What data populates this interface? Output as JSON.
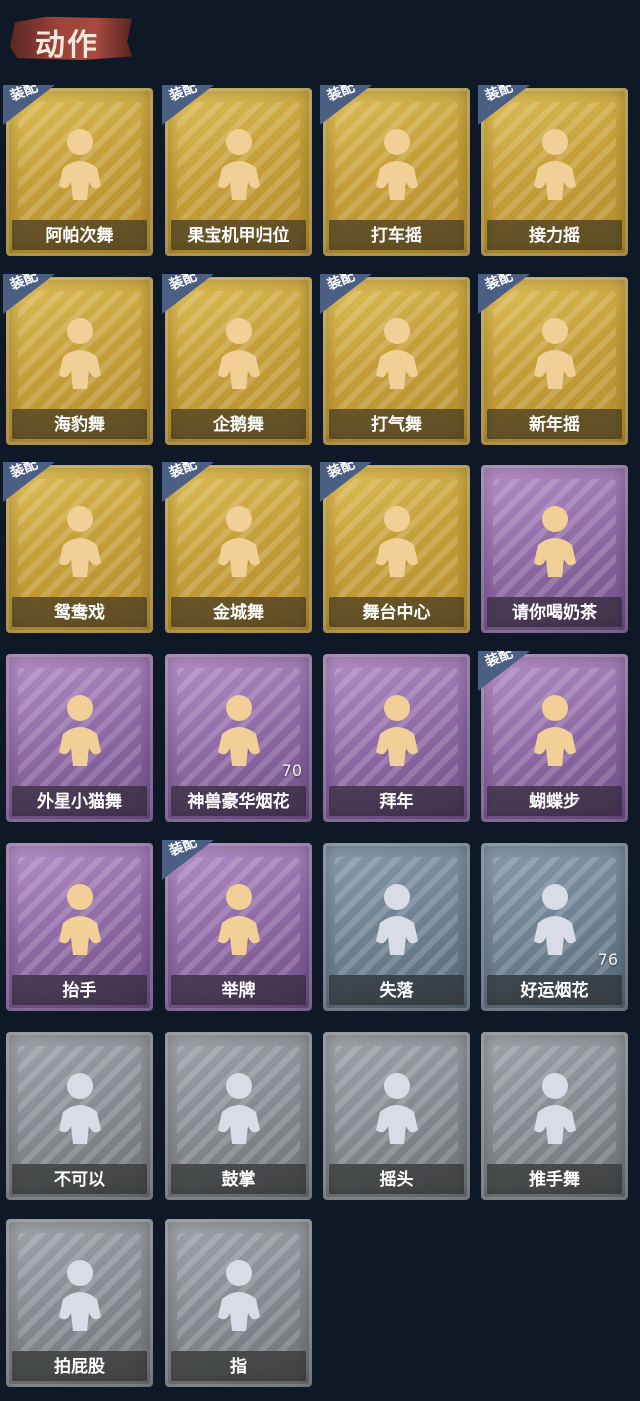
{
  "header": {
    "title": "动作"
  },
  "equip_label": "装配",
  "cards": [
    {
      "label": "阿帕次舞",
      "rarity": "gold",
      "equipped": true,
      "icon": "dancer-icon"
    },
    {
      "label": "果宝机甲归位",
      "rarity": "gold",
      "equipped": true,
      "icon": "dancer-icon"
    },
    {
      "label": "打车摇",
      "rarity": "gold",
      "equipped": true,
      "icon": "dancer-icon"
    },
    {
      "label": "接力摇",
      "rarity": "gold",
      "equipped": true,
      "icon": "dancer-icon"
    },
    {
      "label": "海豹舞",
      "rarity": "gold",
      "equipped": true,
      "icon": "dancer-icon"
    },
    {
      "label": "企鹅舞",
      "rarity": "gold",
      "equipped": true,
      "icon": "dancer-icon"
    },
    {
      "label": "打气舞",
      "rarity": "gold",
      "equipped": true,
      "icon": "dancer-icon"
    },
    {
      "label": "新年摇",
      "rarity": "gold",
      "equipped": true,
      "icon": "dancer-icon"
    },
    {
      "label": "鸳鸯戏",
      "rarity": "gold",
      "equipped": true,
      "icon": "dancer-icon"
    },
    {
      "label": "金城舞",
      "rarity": "gold",
      "equipped": true,
      "icon": "dancer-icon"
    },
    {
      "label": "舞台中心",
      "rarity": "gold",
      "equipped": true,
      "icon": "dancer-icon"
    },
    {
      "label": "请你喝奶茶",
      "rarity": "purple",
      "equipped": false,
      "icon": "figure-banner-icon"
    },
    {
      "label": "外星小猫舞",
      "rarity": "purple",
      "equipped": false,
      "icon": "dancer-icon"
    },
    {
      "label": "神兽豪华烟花",
      "rarity": "purple",
      "equipped": false,
      "icon": "fireworks-icon",
      "count": "70"
    },
    {
      "label": "拜年",
      "rarity": "purple",
      "equipped": false,
      "icon": "bow-figure-icon"
    },
    {
      "label": "蝴蝶步",
      "rarity": "purple",
      "equipped": true,
      "icon": "dancer-icon"
    },
    {
      "label": "抬手",
      "rarity": "purple",
      "equipped": false,
      "icon": "raise-hand-icon"
    },
    {
      "label": "举牌",
      "rarity": "purple",
      "equipped": true,
      "icon": "sign-holder-icon"
    },
    {
      "label": "失落",
      "rarity": "blue",
      "equipped": false,
      "icon": "crawl-figure-icon"
    },
    {
      "label": "好运烟花",
      "rarity": "blue",
      "equipped": false,
      "icon": "firework-can-icon",
      "count": "76"
    },
    {
      "label": "不可以",
      "rarity": "grey",
      "equipped": false,
      "icon": "finger-no-icon"
    },
    {
      "label": "鼓掌",
      "rarity": "grey",
      "equipped": false,
      "icon": "clap-icon"
    },
    {
      "label": "摇头",
      "rarity": "grey",
      "equipped": false,
      "icon": "shake-head-icon"
    },
    {
      "label": "推手舞",
      "rarity": "grey",
      "equipped": false,
      "icon": "push-hands-icon"
    },
    {
      "label": "拍屁股",
      "rarity": "grey",
      "equipped": false,
      "icon": "pat-figure-icon"
    },
    {
      "label": "指",
      "rarity": "grey",
      "equipped": false,
      "icon": "point-icon"
    }
  ]
}
